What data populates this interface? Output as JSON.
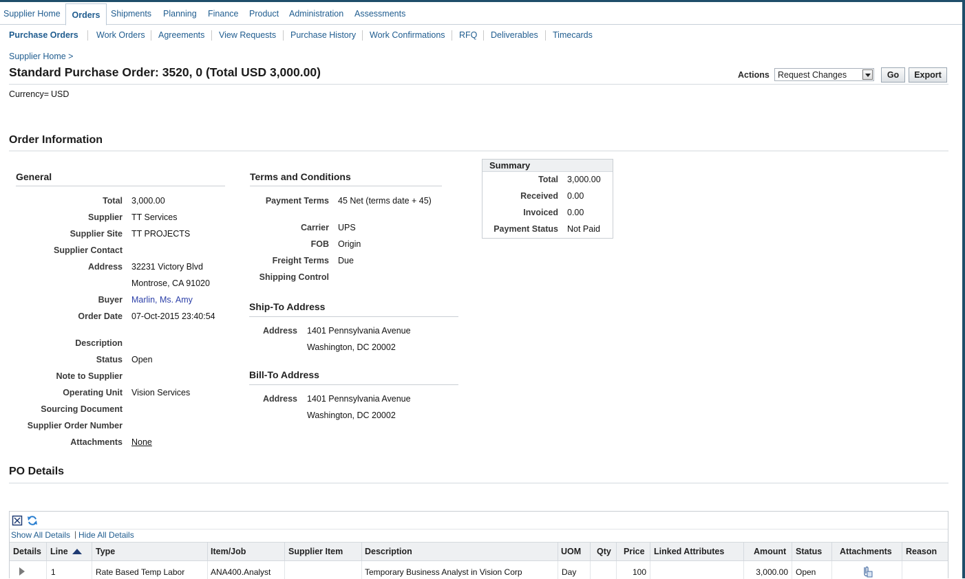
{
  "tabs": [
    "Supplier Home",
    "Orders",
    "Shipments",
    "Planning",
    "Finance",
    "Product",
    "Administration",
    "Assessments"
  ],
  "subtabs": [
    "Purchase Orders",
    "Work Orders",
    "Agreements",
    "View Requests",
    "Purchase History",
    "Work Confirmations",
    "RFQ",
    "Deliverables",
    "Timecards"
  ],
  "breadcrumb": "Supplier Home  >",
  "page_title": "Standard Purchase Order: 3520, 0 (Total USD 3,000.00)",
  "actions": {
    "label": "Actions",
    "selected": "Request Changes",
    "go": "Go",
    "export": "Export"
  },
  "currency": {
    "label": "Currency=",
    "value": "USD"
  },
  "order_information": "Order Information",
  "general": {
    "title": "General",
    "total_label": "Total",
    "total": "3,000.00",
    "supplier_label": "Supplier",
    "supplier": "TT Services",
    "supplier_site_label": "Supplier Site",
    "supplier_site": "TT PROJECTS",
    "supplier_contact_label": "Supplier Contact",
    "address_label": "Address",
    "address_line1": "32231 Victory Blvd",
    "address_line2": "Montrose, CA 91020",
    "buyer_label": "Buyer",
    "buyer": "Marlin, Ms. Amy",
    "order_date_label": "Order Date",
    "order_date": "07-Oct-2015 23:40:54",
    "description_label": "Description",
    "status_label": "Status",
    "status": "Open",
    "note_label": "Note to Supplier",
    "operating_unit_label": "Operating Unit",
    "operating_unit": "Vision Services",
    "sourcing_label": "Sourcing Document",
    "supplier_order_label": "Supplier Order Number",
    "attachments_label": "Attachments",
    "attachments": "None"
  },
  "terms": {
    "title": "Terms and Conditions",
    "payment_terms_label": "Payment Terms",
    "payment_terms": "45 Net (terms date + 45)",
    "carrier_label": "Carrier",
    "carrier": "UPS",
    "fob_label": "FOB",
    "fob": "Origin",
    "freight_label": "Freight Terms",
    "freight": "Due",
    "shipping_label": "Shipping Control"
  },
  "ship_to": {
    "title": "Ship-To Address",
    "label": "Address",
    "line1": "1401 Pennsylvania Avenue",
    "line2": "Washington, DC 20002"
  },
  "bill_to": {
    "title": "Bill-To Address",
    "label": "Address",
    "line1": "1401 Pennsylvania Avenue",
    "line2": "Washington, DC 20002"
  },
  "summary": {
    "title": "Summary",
    "total_label": "Total",
    "total": "3,000.00",
    "received_label": "Received",
    "received": "0.00",
    "invoiced_label": "Invoiced",
    "invoiced": "0.00",
    "payment_status_label": "Payment Status",
    "payment_status": "Not Paid"
  },
  "po_details": {
    "title": "PO Details",
    "show_all": "Show All Details",
    "hide_all": "Hide All Details",
    "columns": [
      "Details",
      "Line",
      "Type",
      "Item/Job",
      "Supplier Item",
      "Description",
      "UOM",
      "Qty",
      "Price",
      "Linked Attributes",
      "Amount",
      "Status",
      "Attachments",
      "Reason"
    ],
    "row": {
      "line": "1",
      "type": "Rate Based Temp Labor",
      "item": "ANA400.Analyst",
      "supplier_item": "",
      "description": "Temporary Business Analyst in Vision Corp",
      "uom": "Day",
      "qty": "",
      "price": "100",
      "linked": "",
      "amount": "3,000.00",
      "status": "Open",
      "reason": ""
    }
  }
}
